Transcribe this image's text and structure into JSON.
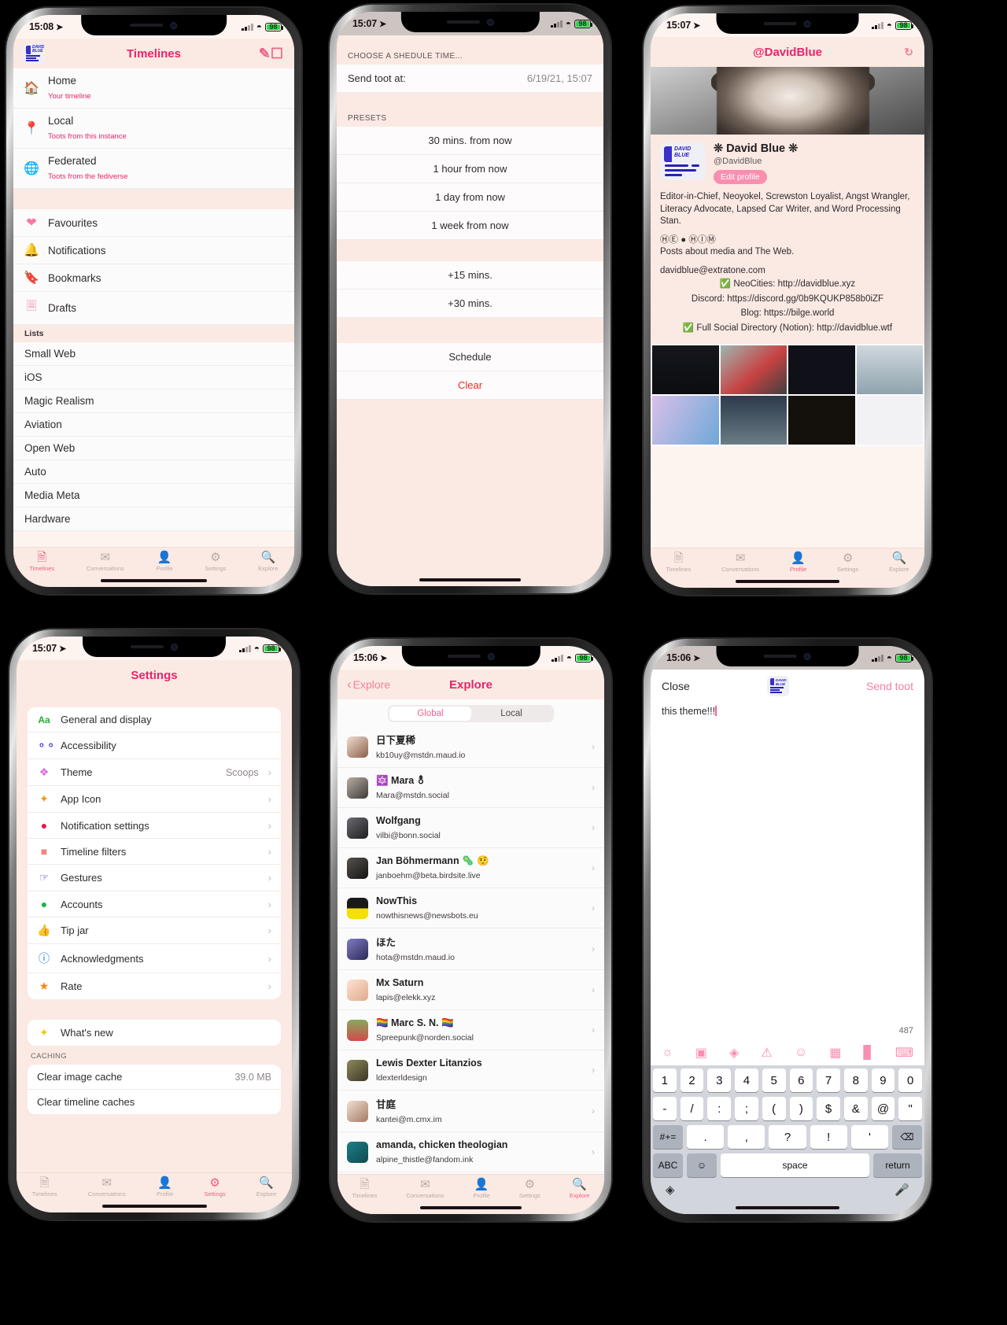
{
  "app": {
    "name": "Mastodon client",
    "theme_accent": "#e8246c",
    "theme_bg": "#fbe9e3"
  },
  "phone1": {
    "status": {
      "time": "15:08",
      "battery": "98"
    },
    "navbar": {
      "title": "Timelines",
      "left_icon": "app-logo-icon",
      "right_icon": "compose-icon"
    },
    "timelines": [
      {
        "icon": "home-icon",
        "title": "Home",
        "subtitle": "Your timeline"
      },
      {
        "icon": "pin-icon",
        "title": "Local",
        "subtitle": "Toots from this instance"
      },
      {
        "icon": "globe-icon",
        "title": "Federated",
        "subtitle": "Toots from the fediverse"
      }
    ],
    "shortcuts": [
      {
        "icon": "heart-icon",
        "title": "Favourites"
      },
      {
        "icon": "bell-icon",
        "title": "Notifications"
      },
      {
        "icon": "bookmark-icon",
        "title": "Bookmarks"
      },
      {
        "icon": "drafts-icon",
        "title": "Drafts"
      }
    ],
    "lists_header": "Lists",
    "lists": [
      "Small Web",
      "iOS",
      "Magic Realism",
      "Aviation",
      "Open Web",
      "Auto",
      "Media Meta",
      "Hardware"
    ],
    "tabs": [
      {
        "label": "Timelines",
        "icon": "timelines-icon",
        "active": true
      },
      {
        "label": "Conversations",
        "icon": "envelope-icon",
        "active": false
      },
      {
        "label": "Profile",
        "icon": "person-icon",
        "active": false
      },
      {
        "label": "Settings",
        "icon": "gear-icon",
        "active": false
      },
      {
        "label": "Explore",
        "icon": "search-icon",
        "active": false
      }
    ]
  },
  "phone2": {
    "status": {
      "time": "15:07",
      "battery": "98"
    },
    "section_header": "CHOOSE A SHEDULE TIME...",
    "send_at_label": "Send toot at:",
    "send_at_value": "6/19/21, 15:07",
    "presets_header": "PRESETS",
    "presets": [
      "30 mins. from now",
      "1 hour from now",
      "1 day from now",
      "1 week from now"
    ],
    "increments": [
      "+15 mins.",
      "+30 mins."
    ],
    "actions": [
      {
        "label": "Schedule",
        "destructive": false
      },
      {
        "label": "Clear",
        "destructive": true
      }
    ]
  },
  "phone3": {
    "status": {
      "time": "15:07",
      "battery": "98"
    },
    "navbar": {
      "title": "@DavidBlue",
      "right_icon": "refresh-icon"
    },
    "profile": {
      "display_name": "❊ David Blue ❊",
      "handle": "@DavidBlue",
      "edit_label": "Edit profile",
      "bio_paragraph": "Editor-in-Chief, Neoyokel, Screwston Loyalist, Angst Wrangler, Literacy Advocate, Lapsed Car Writer, and Word Processing Stan.",
      "bio_symbols": "ⒽⒺ ● ⒽⒾⓂ",
      "bio_tagline": "Posts about media and The Web.",
      "email": "davidblue@extratone.com",
      "links": [
        "✅ NeoCities: http://davidblue.xyz",
        "Discord: https://discord.gg/0b9KQUKP858b0iZF",
        "Blog: https://bilge.world",
        "✅ Full Social Directory (Notion): http://davidblue.wtf"
      ]
    },
    "tabs": [
      {
        "label": "Timelines",
        "icon": "timelines-icon",
        "active": false
      },
      {
        "label": "Conversations",
        "icon": "envelope-icon",
        "active": false
      },
      {
        "label": "Profile",
        "icon": "person-icon",
        "active": true
      },
      {
        "label": "Settings",
        "icon": "gear-icon",
        "active": false
      },
      {
        "label": "Explore",
        "icon": "search-icon",
        "active": false
      }
    ]
  },
  "phone4": {
    "status": {
      "time": "15:07",
      "battery": "98"
    },
    "navbar": {
      "title": "Settings"
    },
    "settings": [
      {
        "icon": "text-size-icon",
        "glyph": "Aa",
        "color": "#23b02d",
        "label": "General and display",
        "value": "",
        "chevron": false
      },
      {
        "icon": "glasses-icon",
        "glyph": "∞",
        "color": "#2a20d8",
        "label": "Accessibility",
        "value": "",
        "chevron": false
      },
      {
        "icon": "paintbrush-icon",
        "glyph": "🖌",
        "color": "#d86ce0",
        "label": "Theme",
        "value": "Scoops",
        "chevron": true
      },
      {
        "icon": "sparkle-icon",
        "glyph": "✦",
        "color": "#f59a15",
        "label": "App Icon",
        "value": "",
        "chevron": true
      },
      {
        "icon": "bell-badge-icon",
        "glyph": "🔔",
        "color": "#e3174f",
        "label": "Notification settings",
        "value": "",
        "chevron": true
      },
      {
        "icon": "filter-trash-icon",
        "glyph": "🗑",
        "color": "#f2867e",
        "label": "Timeline filters",
        "value": "",
        "chevron": true
      },
      {
        "icon": "hand-tap-icon",
        "glyph": "✋",
        "color": "#4a3fd0",
        "label": "Gestures",
        "value": "",
        "chevron": true
      },
      {
        "icon": "accounts-icon",
        "glyph": "👤",
        "color": "#21b24b",
        "label": "Accounts",
        "value": "",
        "chevron": true
      },
      {
        "icon": "thumbs-up-icon",
        "glyph": "👍",
        "color": "#4aa3e8",
        "label": "Tip jar",
        "value": "",
        "chevron": true
      },
      {
        "icon": "info-icon",
        "glyph": "i",
        "color": "#1268e0",
        "label": "Acknowledgments",
        "value": "",
        "chevron": true
      },
      {
        "icon": "star-icon",
        "glyph": "★",
        "color": "#f08a12",
        "label": "Rate",
        "value": "",
        "chevron": true
      }
    ],
    "whats_new": {
      "icon": "sparkle-icon",
      "glyph": "✦",
      "color": "#f5c518",
      "label": "What's new"
    },
    "caching_header": "CACHING",
    "caching": [
      {
        "label": "Clear image cache",
        "value": "39.0 MB"
      },
      {
        "label": "Clear timeline caches",
        "value": ""
      }
    ],
    "tabs": [
      {
        "label": "Timelines",
        "icon": "timelines-icon",
        "active": false
      },
      {
        "label": "Conversations",
        "icon": "envelope-icon",
        "active": false
      },
      {
        "label": "Profile",
        "icon": "person-icon",
        "active": false
      },
      {
        "label": "Settings",
        "icon": "gear-icon",
        "active": true
      },
      {
        "label": "Explore",
        "icon": "search-icon",
        "active": false
      }
    ]
  },
  "phone5": {
    "status": {
      "time": "15:06",
      "battery": "98"
    },
    "navbar": {
      "back_label": "Explore",
      "title": "Explore"
    },
    "segments": [
      {
        "label": "Global",
        "active": true
      },
      {
        "label": "Local",
        "active": false
      }
    ],
    "users": [
      {
        "name": "日下夏稀",
        "account": "kb10uy@mstdn.maud.io",
        "avatar_color": "#e3c7b5"
      },
      {
        "name": "🔯 Mara ⚨",
        "account": "Mara@mstdn.social",
        "avatar_color": "#7d7a86"
      },
      {
        "name": "Wolfgang",
        "account": "vilbi@bonn.social",
        "avatar_color": "#3a3a40"
      },
      {
        "name": "Jan Böhmermann 🦠 🤨",
        "account": "janboehm@beta.birdsite.live",
        "avatar_color": "#24211f"
      },
      {
        "name": "NowThis",
        "account": "nowthisnews@newsbots.eu",
        "avatar_color": "#f4e003"
      },
      {
        "name": "ほた",
        "account": "hota@mstdn.maud.io",
        "avatar_color": "#4b4a8c"
      },
      {
        "name": "Mx Saturn",
        "account": "lapis@elekk.xyz",
        "avatar_color": "#f0c8b4"
      },
      {
        "name": "🏳️‍🌈 Marc S. N. 🏳️‍🌈",
        "account": "Spreepunk@norden.social",
        "avatar_color": "#7fa65c"
      },
      {
        "name": "Lewis Dexter Litanzios",
        "account": "ldexterldesign",
        "avatar_color": "#6c6b4a"
      },
      {
        "name": "甘庭",
        "account": "kantei@m.cmx.im",
        "avatar_color": "#d8c5b8"
      },
      {
        "name": "amanda, chicken theologian",
        "account": "alpine_thistle@fandom.ink",
        "avatar_color": "#176a72"
      }
    ],
    "tabs": [
      {
        "label": "Timelines",
        "icon": "timelines-icon",
        "active": false
      },
      {
        "label": "Conversations",
        "icon": "envelope-icon",
        "active": false
      },
      {
        "label": "Profile",
        "icon": "person-icon",
        "active": false
      },
      {
        "label": "Settings",
        "icon": "gear-icon",
        "active": false
      },
      {
        "label": "Explore",
        "icon": "search-icon",
        "active": true
      }
    ]
  },
  "phone6": {
    "status": {
      "time": "15:06",
      "battery": "98"
    },
    "compose": {
      "close_label": "Close",
      "logo_icon": "app-logo-icon",
      "send_label": "Send toot",
      "text": "this theme!!!",
      "char_count": "487"
    },
    "toolbar_icons": [
      "camera-icon",
      "photo-icon",
      "globe-icon",
      "content-warning-icon",
      "emoji-icon",
      "calendar-icon",
      "poll-icon",
      "keyboard-icon"
    ],
    "keyboard": {
      "row1": [
        "1",
        "2",
        "3",
        "4",
        "5",
        "6",
        "7",
        "8",
        "9",
        "0"
      ],
      "row2": [
        "-",
        "/",
        ":",
        ";",
        "(",
        ")",
        "$",
        "&",
        "@",
        "\""
      ],
      "row3_left": "#+=",
      "row3": [
        ".",
        ",",
        "?",
        "!",
        "'"
      ],
      "row3_right": "delete-icon",
      "row4_abc": "ABC",
      "row4_emoji": "emoji-icon",
      "row4_space": "space",
      "row4_return": "return",
      "globe_icon": "globe-icon",
      "mic_icon": "microphone-icon"
    }
  }
}
